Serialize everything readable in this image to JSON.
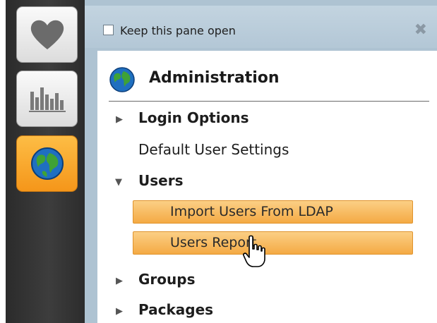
{
  "rail": {
    "buttons": [
      {
        "icon": "heart-icon",
        "active": false
      },
      {
        "icon": "bar-chart-icon",
        "active": false
      },
      {
        "icon": "globe-icon",
        "active": true
      }
    ]
  },
  "pane": {
    "keep_open_label": "Keep this pane open",
    "keep_open_checked": false,
    "close_icon": "close-icon",
    "section_title": "Administration",
    "items": [
      {
        "label": "Login Options",
        "type": "collapsed-group"
      },
      {
        "label": "Default User Settings",
        "type": "link"
      },
      {
        "label": "Users",
        "type": "expanded-group"
      },
      {
        "label": "Import Users From LDAP",
        "type": "sub-item-highlighted"
      },
      {
        "label": "Users Report",
        "type": "sub-item-highlighted"
      },
      {
        "label": "Groups",
        "type": "collapsed-group"
      },
      {
        "label": "Packages",
        "type": "collapsed-group"
      }
    ]
  },
  "colors": {
    "accent_orange": "#f5a12e",
    "pane_blue": "#b6c9d8",
    "rail_dark": "#333333"
  }
}
